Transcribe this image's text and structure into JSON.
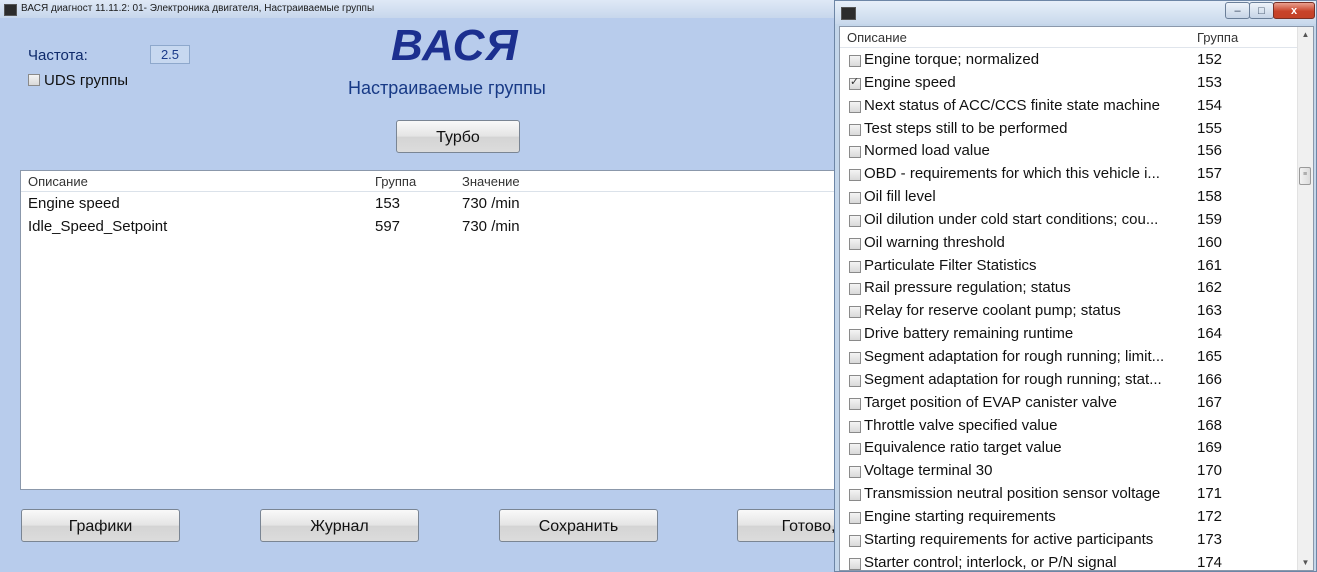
{
  "main_window": {
    "title": "ВАСЯ диагност 11.11.2: 01- Электроника двигателя,  Настраиваемые группы",
    "frequency_label": "Частота:",
    "frequency_value": "2.5",
    "uds_groups_label": "UDS группы",
    "uds_groups_checked": false,
    "logo": "ВАСЯ",
    "subtitle": "Настраиваемые группы",
    "turbo_button": "Турбо",
    "table": {
      "columns": [
        "Описание",
        "Группа",
        "Значение"
      ],
      "rows": [
        {
          "description": "Engine speed",
          "group": "153",
          "value": "730 /min"
        },
        {
          "description": "Idle_Speed_Setpoint",
          "group": "597",
          "value": "730 /min"
        }
      ]
    },
    "buttons": {
      "graphs": "Графики",
      "journal": "Журнал",
      "save": "Сохранить",
      "done": "Готово, Н"
    }
  },
  "picker_window": {
    "title": "",
    "controls": {
      "minimize": "–",
      "maximize": "□",
      "close": "x"
    },
    "columns": [
      "Описание",
      "Группа"
    ],
    "items": [
      {
        "description": "Engine torque; normalized",
        "group": "152",
        "checked": false
      },
      {
        "description": "Engine speed",
        "group": "153",
        "checked": true
      },
      {
        "description": "Next status of ACC/CCS finite state machine",
        "group": "154",
        "checked": false
      },
      {
        "description": "Test steps still to be performed",
        "group": "155",
        "checked": false
      },
      {
        "description": "Normed load value",
        "group": "156",
        "checked": false
      },
      {
        "description": "OBD - requirements for which this vehicle i...",
        "group": "157",
        "checked": false
      },
      {
        "description": "Oil fill level",
        "group": "158",
        "checked": false
      },
      {
        "description": "Oil dilution under cold start conditions; cou...",
        "group": "159",
        "checked": false
      },
      {
        "description": "Oil warning threshold",
        "group": "160",
        "checked": false
      },
      {
        "description": "Particulate Filter Statistics",
        "group": "161",
        "checked": false
      },
      {
        "description": "Rail pressure regulation; status",
        "group": "162",
        "checked": false
      },
      {
        "description": "Relay for reserve coolant pump; status",
        "group": "163",
        "checked": false
      },
      {
        "description": "Drive battery remaining runtime",
        "group": "164",
        "checked": false
      },
      {
        "description": "Segment adaptation for rough running; limit...",
        "group": "165",
        "checked": false
      },
      {
        "description": "Segment adaptation for rough running; stat...",
        "group": "166",
        "checked": false
      },
      {
        "description": "Target position of EVAP canister valve",
        "group": "167",
        "checked": false
      },
      {
        "description": "Throttle valve specified value",
        "group": "168",
        "checked": false
      },
      {
        "description": "Equivalence ratio target value",
        "group": "169",
        "checked": false
      },
      {
        "description": "Voltage terminal 30",
        "group": "170",
        "checked": false
      },
      {
        "description": "Transmission neutral position sensor voltage",
        "group": "171",
        "checked": false
      },
      {
        "description": "Engine starting requirements",
        "group": "172",
        "checked": false
      },
      {
        "description": "Starting requirements for active participants",
        "group": "173",
        "checked": false
      },
      {
        "description": "Starter control; interlock, or P/N signal",
        "group": "174",
        "checked": false
      }
    ],
    "scrollbar": {
      "up_icon": "▲",
      "down_icon": "▼",
      "thumb_grip": "≡"
    }
  }
}
